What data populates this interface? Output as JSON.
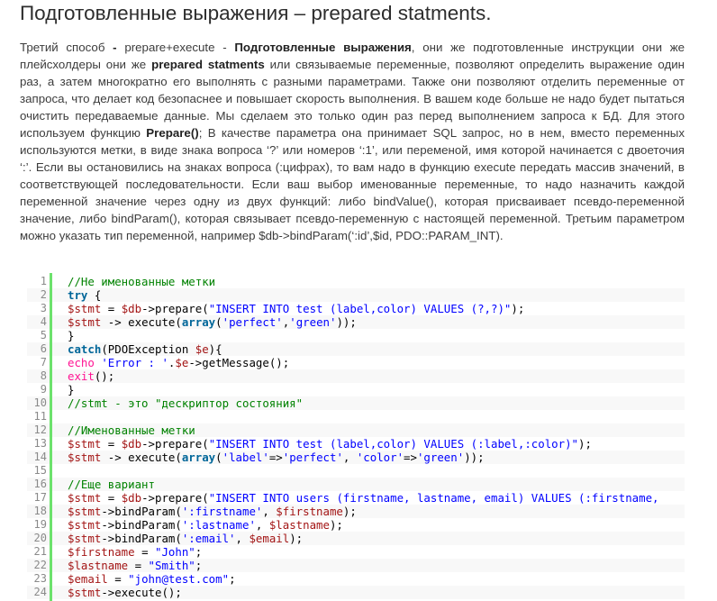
{
  "title": "Подготовленные выражения – prepared statments.",
  "paragraph": [
    {
      "t": "Третий способ "
    },
    {
      "t": "- ",
      "b": true
    },
    {
      "t": "prepare+execute - "
    },
    {
      "t": "Подготовленные выражения",
      "b": true
    },
    {
      "t": ", они же подготовленные инструкции они же плейсхолдеры они же "
    },
    {
      "t": "prepared statments",
      "b": true
    },
    {
      "t": " или связываемые переменные, позволяют определить выражение один раз, а затем многократно его выполнять с разными параметрами. Также они позволяют отделить переменные от запроса, что делает код безопаснее и повышает скорость выполнения. В вашем коде больше не надо будет пытаться очистить передаваемые данные. Мы сделаем это только один раз перед выполнением запроса к БД. Для этого используем функцию "
    },
    {
      "t": "Prepare()",
      "b": true
    },
    {
      "t": "; В качестве параметра она принимает SQL запрос, но в нем, вместо переменных используются метки, в виде знака вопроса ‘?’ или номеров ‘:1’, или переменой, имя которой начинается с двоеточия ‘:’. Если вы остановились на знаках вопроса (:цифрах), то вам надо в функцию execute передать массив значений, в соответствующей последовательности. Если ваш выбор именованные переменные, то надо назначить каждой переменной значение через одну из двух функций: либо bindValue(), которая присваивает псевдо-переменной значение, либо bindParam(), которая связывает псевдо-переменную с настоящей переменной. Третьим параметром можно указать тип переменной, например $db->bindParam(‘:id’,$id, PDO::PARAM_INT)."
    }
  ],
  "code": {
    "line_numbers": [
      "1",
      "2",
      "3",
      "4",
      "5",
      "6",
      "7",
      "8",
      "9",
      "10",
      "11",
      "12",
      "13",
      "14",
      "15",
      "16",
      "17",
      "18",
      "19",
      "20",
      "21",
      "22",
      "23",
      "24"
    ],
    "lines": [
      [
        {
          "t": "//Не именованные метки",
          "c": "com"
        }
      ],
      [
        {
          "t": "try",
          "c": "kw"
        },
        {
          "t": " {"
        }
      ],
      [
        {
          "t": "$stmt",
          "c": "var"
        },
        {
          "t": " = "
        },
        {
          "t": "$db",
          "c": "var"
        },
        {
          "t": "->prepare("
        },
        {
          "t": "\"INSERT INTO test (label,color) VALUES (?,?)\"",
          "c": "str"
        },
        {
          "t": ");"
        }
      ],
      [
        {
          "t": "$stmt",
          "c": "var"
        },
        {
          "t": " -> execute("
        },
        {
          "t": "array",
          "c": "kw"
        },
        {
          "t": "("
        },
        {
          "t": "'perfect'",
          "c": "str"
        },
        {
          "t": ","
        },
        {
          "t": "'green'",
          "c": "str"
        },
        {
          "t": "));"
        }
      ],
      [
        {
          "t": "}"
        }
      ],
      [
        {
          "t": "catch",
          "c": "kw"
        },
        {
          "t": "(PDOException "
        },
        {
          "t": "$e",
          "c": "var"
        },
        {
          "t": "){"
        }
      ],
      [
        {
          "t": "echo",
          "c": "fn"
        },
        {
          "t": " "
        },
        {
          "t": "'Error : '",
          "c": "str"
        },
        {
          "t": "."
        },
        {
          "t": "$e",
          "c": "var"
        },
        {
          "t": "->getMessage();"
        }
      ],
      [
        {
          "t": "exit",
          "c": "fn"
        },
        {
          "t": "();"
        }
      ],
      [
        {
          "t": "}"
        }
      ],
      [
        {
          "t": "//stmt - это \"дескриптор состояния\"",
          "c": "com"
        }
      ],
      [],
      [
        {
          "t": "//Именованные метки",
          "c": "com"
        }
      ],
      [
        {
          "t": "$stmt",
          "c": "var"
        },
        {
          "t": " = "
        },
        {
          "t": "$db",
          "c": "var"
        },
        {
          "t": "->prepare("
        },
        {
          "t": "\"INSERT INTO test (label,color) VALUES (:label,:color)\"",
          "c": "str"
        },
        {
          "t": ");"
        }
      ],
      [
        {
          "t": "$stmt",
          "c": "var"
        },
        {
          "t": " -> execute("
        },
        {
          "t": "array",
          "c": "kw"
        },
        {
          "t": "("
        },
        {
          "t": "'label'",
          "c": "str"
        },
        {
          "t": "=>"
        },
        {
          "t": "'perfect'",
          "c": "str"
        },
        {
          "t": ", "
        },
        {
          "t": "'color'",
          "c": "str"
        },
        {
          "t": "=>"
        },
        {
          "t": "'green'",
          "c": "str"
        },
        {
          "t": "));"
        }
      ],
      [],
      [
        {
          "t": "//Еще вариант",
          "c": "com"
        }
      ],
      [
        {
          "t": "$stmt",
          "c": "var"
        },
        {
          "t": " = "
        },
        {
          "t": "$db",
          "c": "var"
        },
        {
          "t": "->prepare("
        },
        {
          "t": "\"INSERT INTO users (firstname, lastname, email) VALUES (:firstname,",
          "c": "str"
        }
      ],
      [
        {
          "t": "$stmt",
          "c": "var"
        },
        {
          "t": "->bindParam("
        },
        {
          "t": "':firstname'",
          "c": "str"
        },
        {
          "t": ", "
        },
        {
          "t": "$firstname",
          "c": "var"
        },
        {
          "t": ");"
        }
      ],
      [
        {
          "t": "$stmt",
          "c": "var"
        },
        {
          "t": "->bindParam("
        },
        {
          "t": "':lastname'",
          "c": "str"
        },
        {
          "t": ", "
        },
        {
          "t": "$lastname",
          "c": "var"
        },
        {
          "t": ");"
        }
      ],
      [
        {
          "t": "$stmt",
          "c": "var"
        },
        {
          "t": "->bindParam("
        },
        {
          "t": "':email'",
          "c": "str"
        },
        {
          "t": ", "
        },
        {
          "t": "$email",
          "c": "var"
        },
        {
          "t": ");"
        }
      ],
      [
        {
          "t": "$firstname",
          "c": "var"
        },
        {
          "t": " = "
        },
        {
          "t": "\"John\"",
          "c": "str"
        },
        {
          "t": ";"
        }
      ],
      [
        {
          "t": "$lastname",
          "c": "var"
        },
        {
          "t": " = "
        },
        {
          "t": "\"Smith\"",
          "c": "str"
        },
        {
          "t": ";"
        }
      ],
      [
        {
          "t": "$email",
          "c": "var"
        },
        {
          "t": " = "
        },
        {
          "t": "\"john@test.com\"",
          "c": "str"
        },
        {
          "t": ";"
        }
      ],
      [
        {
          "t": "$stmt",
          "c": "var"
        },
        {
          "t": "->execute();"
        }
      ]
    ]
  },
  "colors": {
    "gutter_border": "#6ce26c",
    "comment": "#008200",
    "keyword": "#006699",
    "variable": "#a31515",
    "string": "#0000ff",
    "function": "#ff1493"
  }
}
